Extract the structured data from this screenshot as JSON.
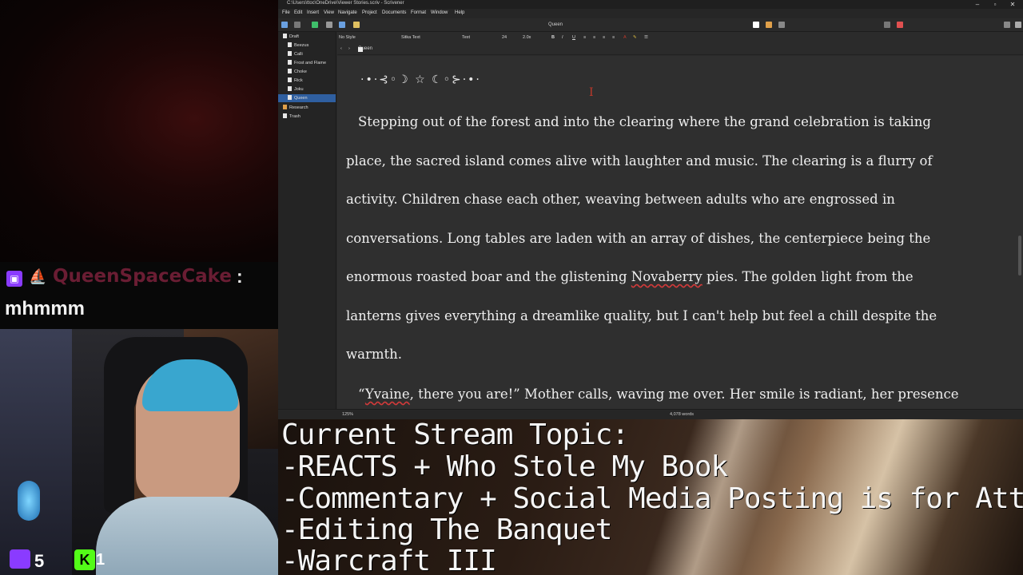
{
  "chat": {
    "username": "QueenSpaceCake",
    "colon": ":",
    "message": "mhmmm"
  },
  "counters": {
    "twitch_viewers": "5",
    "kick_viewers": "1",
    "kick_letter": "K"
  },
  "window": {
    "title": "C:\\Users\\ttoc\\OneDrive\\Viewer Stories.scriv - Scrivener",
    "minimize": "–",
    "maximize": "▫",
    "close": "✕"
  },
  "menu": [
    "File",
    "Edit",
    "Insert",
    "View",
    "Navigate",
    "Project",
    "Documents",
    "Format",
    "Window",
    "Help"
  ],
  "toolbar": {
    "document_title": "Queen"
  },
  "binder": {
    "items": [
      {
        "label": "Draft"
      },
      {
        "label": "Beezus"
      },
      {
        "label": "Calli"
      },
      {
        "label": "Frost and Flame"
      },
      {
        "label": "Choke"
      },
      {
        "label": "Rick"
      },
      {
        "label": "Joku"
      },
      {
        "label": "Queen"
      },
      {
        "label": "Research"
      },
      {
        "label": "Trash"
      }
    ]
  },
  "format_bar": {
    "style": "No Style",
    "font": "Sitka Text",
    "typeface": "Text",
    "size": "24",
    "line_spacing": "2.0x"
  },
  "editor": {
    "header_doc": "Queen",
    "ornament": "·•·⊰◦☽ ☆ ☾◦⊱·•·",
    "cursor": "I",
    "para1_lines": [
      "Stepping out of the forest and into the clearing where the grand celebration is taking",
      "place, the sacred island comes alive with laughter and music. The clearing is a flurry of",
      "activity. Children chase each other, weaving between adults who are engrossed in",
      "conversations. Long tables are laden with an array of dishes, the centerpiece being the"
    ],
    "para1_line5_before": "enormous roasted boar and the glistening ",
    "para1_line5_spell": "Novaberry",
    "para1_line5_after": " pies. The golden light from the",
    "para1_line6": "lanterns gives everything a dreamlike quality, but I can't help but feel a chill despite the",
    "para1_line7": "warmth.",
    "para2_open_quote": "“",
    "para2_spell": "Yvaine",
    "para2_rest": ", there you are!” Mother calls, waving me over. Her smile is radiant, her presence"
  },
  "footer": {
    "zoom": "125%",
    "word_count": "4,078 words"
  },
  "stream_topic": {
    "lines": [
      "Current Stream Topic:",
      "-REACTS + Who Stole My Book",
      "-Commentary + Social Media Posting is for Atten",
      "-Editing The Banquet",
      "-Warcraft III"
    ]
  }
}
